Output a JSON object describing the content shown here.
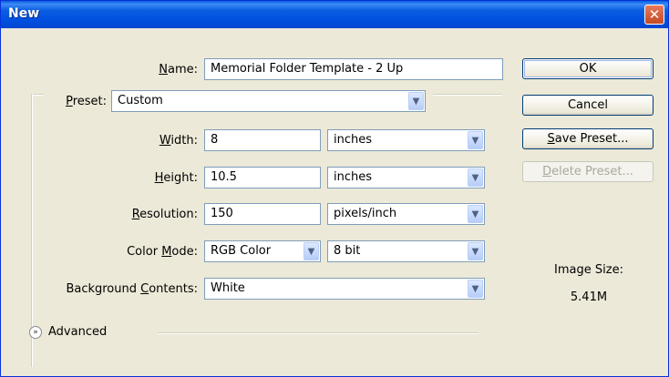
{
  "window": {
    "title": "New",
    "close": "✕"
  },
  "name": {
    "label": "Name:",
    "value": "Memorial Folder Template - 2 Up"
  },
  "preset": {
    "label": "Preset:",
    "value": "Custom"
  },
  "width": {
    "label": "Width:",
    "value": "8",
    "unit": "inches"
  },
  "height": {
    "label": "Height:",
    "value": "10.5",
    "unit": "inches"
  },
  "resolution": {
    "label": "Resolution:",
    "value": "150",
    "unit": "pixels/inch"
  },
  "color_mode": {
    "label": "Color Mode:",
    "value": "RGB Color",
    "depth": "8 bit"
  },
  "background": {
    "label": "Background Contents:",
    "value": "White"
  },
  "advanced": {
    "label": "Advanced",
    "icon": "chevron-down-icon"
  },
  "buttons": {
    "ok": "OK",
    "cancel": "Cancel",
    "save_preset": "Save Preset...",
    "delete_preset": "Delete Preset..."
  },
  "image_size": {
    "label": "Image Size:",
    "value": "5.41M"
  },
  "colors": {
    "titlebar": "#0a5de0",
    "face": "#ece9d8",
    "border": "#7f9db9"
  }
}
